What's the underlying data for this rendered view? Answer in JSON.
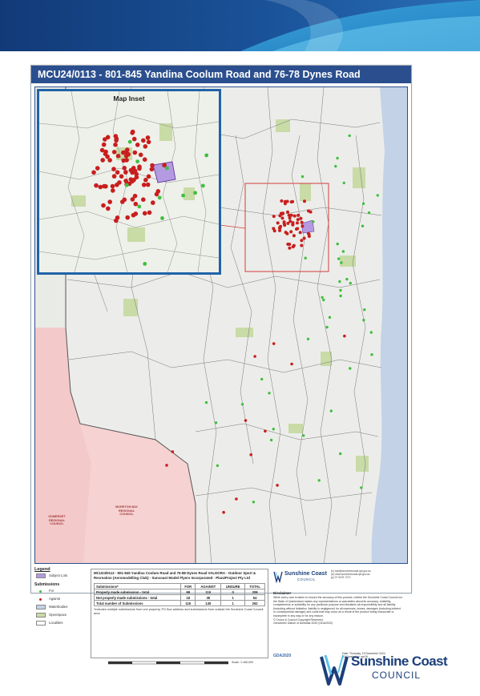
{
  "map_title": "MCU24/0113 - 801-845 Yandina Coolum Road and 76-78 Dynes Road",
  "inset_title": "Map Inset",
  "region_labels": {
    "somerset": "SOMERSET REGIONAL COUNCIL",
    "moreton_bay": "MORETON BAY REGIONAL COUNCIL"
  },
  "legend": {
    "title": "Legend",
    "subject_lots": "Subject Lots",
    "submissions_heading": "Submissions",
    "for": "For",
    "against": "Against",
    "waterbodies": "Waterbodies",
    "openspace": "OpenSpace",
    "localities": "Localities"
  },
  "colors": {
    "banner_dark": "#123a78",
    "title_bar": "#2b4f8e",
    "inset_border": "#2063a8",
    "for_dot": "#3fbf3f",
    "against_dot": "#c81e1e",
    "subject_lot": "#b49ae0",
    "waterbody": "#c3d2e6",
    "openspace": "#c9dba6",
    "neighbour_council": "#f4c9c9",
    "logo_blue": "#1c3f7a"
  },
  "info": {
    "title": "MCU24/0113 - 801-845 Yandina Coolum Road and 76-88 Dynes Road VALDORA - Outdoor Sport & Recreation (Aeromodelling Club) - Suncoast Model Flyers Incorporated - Plan2Project Pty Ltd",
    "headers": [
      "Submissions*",
      "FOR",
      "AGAINST",
      "UNSURE",
      "TOTAL"
    ],
    "rows": [
      [
        "Properly made submission - total",
        "98",
        "110",
        "0",
        "208"
      ],
      [
        "Not properly made submissions - total",
        "18",
        "35",
        "1",
        "54"
      ],
      [
        "Total number of Submissions",
        "116",
        "145",
        "1",
        "262"
      ]
    ],
    "note": "*Includes multiple submissions from one property, PO Box address and submissions from outside the Sunshine Coast Council area"
  },
  "scale_text": "Scale: 1:180,000",
  "council_small": {
    "name": "Sunshine Coast",
    "council": "COUNCIL",
    "contact_lines": [
      "(e) mail@sunshinecoast.qld.gov.au",
      "(w) www.sunshinecoast.qld.gov.au",
      "(p) 07 5475 7272"
    ]
  },
  "disclaimer": {
    "title": "Disclaimer",
    "text": "While every care is taken to ensure the accuracy of this product, neither the Sunshine Coast Council nor the State of Queensland makes any representations or warranties about its accuracy, reliability, completeness or suitability for any particular purpose and disclaims all responsibility and all liability (including without limitation, liability in negligence) for all expenses, losses, damages (including indirect or consequential damage) and costs that may occur as a result of the product being inaccurate or incomplete in any way or for any reason.",
    "copyright": "© Crown & Council Copyright Reserved.",
    "datum": "Geocentric Datum of Australia 2020 (GDA2020)"
  },
  "gda": "GDA2020",
  "date_lines": [
    "Date: Thursday, 19 December 2024",
    "A3 Created by: spt16"
  ],
  "logo": {
    "name": "Sunshine Coast",
    "council": "COUNCIL"
  }
}
